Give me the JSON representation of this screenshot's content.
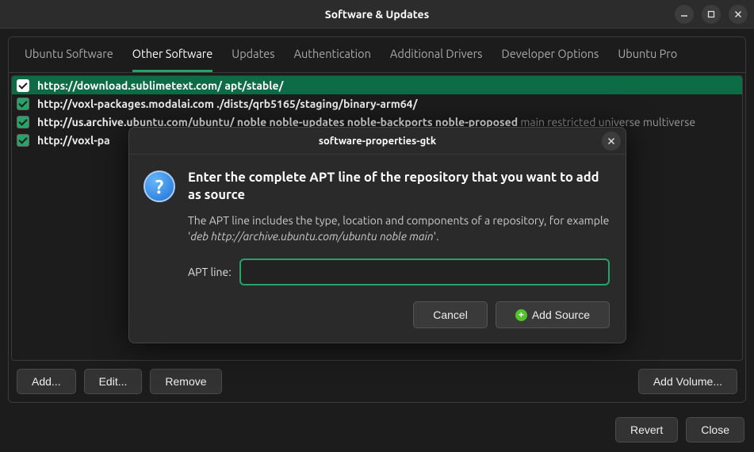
{
  "window": {
    "title": "Software & Updates"
  },
  "tabs": {
    "items": [
      {
        "label": "Ubuntu Software",
        "active": false
      },
      {
        "label": "Other Software",
        "active": true
      },
      {
        "label": "Updates",
        "active": false
      },
      {
        "label": "Authentication",
        "active": false
      },
      {
        "label": "Additional Drivers",
        "active": false
      },
      {
        "label": "Developer Options",
        "active": false
      },
      {
        "label": "Ubuntu Pro",
        "active": false
      }
    ]
  },
  "sources": [
    {
      "checked": true,
      "selected": true,
      "main": "https://download.sublimetext.com/ apt/stable/",
      "extra": ""
    },
    {
      "checked": true,
      "selected": false,
      "main": "http://voxl-packages.modalai.com ./dists/qrb5165/staging/binary-arm64/",
      "extra": ""
    },
    {
      "checked": true,
      "selected": false,
      "main": "http://us.archive.ubuntu.com/ubuntu/ noble noble-updates noble-backports noble-proposed",
      "extra": " main restricted universe multiverse"
    },
    {
      "checked": true,
      "selected": false,
      "main": "http://voxl-pa",
      "extra": ""
    }
  ],
  "actions": {
    "add": "Add...",
    "edit": "Edit...",
    "remove": "Remove",
    "add_volume": "Add Volume..."
  },
  "footer": {
    "revert": "Revert",
    "close": "Close"
  },
  "dialog": {
    "title": "software-properties-gtk",
    "heading": "Enter the complete APT line of the repository that you want to add as source",
    "description_prefix": "The APT line includes the type, location and components of a repository, for example  '",
    "description_example": "deb http://archive.ubuntu.com/ubuntu noble main",
    "description_suffix": "'.",
    "input_label": "APT line:",
    "input_value": "",
    "cancel": "Cancel",
    "add_source": "Add Source"
  }
}
